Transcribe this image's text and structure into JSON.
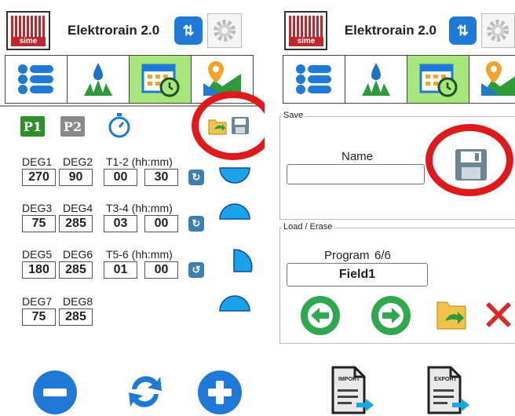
{
  "app": {
    "title": "Elektrorain 2.0",
    "logo_text": "sime"
  },
  "colors": {
    "active_tab": "#a6e67a",
    "alert_ring": "#e01a1a",
    "p1": "#2f8f2a",
    "p2": "#8a8a8a",
    "primary": "#1e7ad6"
  },
  "tabs": [
    {
      "icon": "list-icon",
      "active": false
    },
    {
      "icon": "irrigation-icon",
      "active": false
    },
    {
      "icon": "calendar-timer-icon",
      "active": true
    },
    {
      "icon": "map-pin-icon",
      "active": false
    }
  ],
  "left": {
    "program_buttons": {
      "p1": "P1",
      "p2": "P2"
    },
    "rows": [
      {
        "deg_a_label": "DEG1",
        "deg_a": "270",
        "deg_b_label": "DEG2",
        "deg_b": "90",
        "time_label": "T1-2 (hh:mm)",
        "hh": "00",
        "mm": "30",
        "reset": "↻",
        "sector_icon": "sector-bottom-icon"
      },
      {
        "deg_a_label": "DEG3",
        "deg_a": "75",
        "deg_b_label": "DEG4",
        "deg_b": "285",
        "time_label": "T3-4 (hh:mm)",
        "hh": "03",
        "mm": "00",
        "reset": "↻",
        "sector_icon": "sector-top-icon"
      },
      {
        "deg_a_label": "DEG5",
        "deg_a": "180",
        "deg_b_label": "DEG6",
        "deg_b": "285",
        "time_label": "T5-6 (hh:mm)",
        "hh": "01",
        "mm": "00",
        "reset": "↺",
        "sector_icon": "sector-right-icon"
      },
      {
        "deg_a_label": "DEG7",
        "deg_a": "75",
        "deg_b_label": "DEG8",
        "deg_b": "285",
        "sector_icon": "sector-top-icon"
      }
    ],
    "bottom_buttons": [
      "minus-icon",
      "sync-icon",
      "plus-icon"
    ]
  },
  "right": {
    "save": {
      "legend": "Save",
      "name_label": "Name",
      "name_value": "",
      "save_icon": "floppy-disk-icon"
    },
    "load": {
      "legend": "Load / Erase",
      "program_label": "Program",
      "program_counter": "6/6",
      "field_name": "Field1"
    },
    "import_label": "IMPORT",
    "export_label": "EXPORT"
  }
}
